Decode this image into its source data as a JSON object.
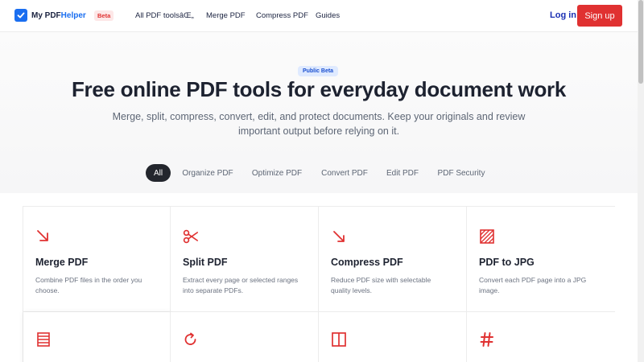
{
  "header": {
    "logo_text_prefix": "My PDF",
    "logo_text_suffix": "Helper",
    "beta_badge": "Beta",
    "nav": {
      "all_tools": "All PDF toolsâŒ„",
      "merge": "Merge PDF",
      "compress": "Compress PDF",
      "guides": "Guides"
    },
    "login": "Log in",
    "signup": "Sign up"
  },
  "hero": {
    "badge": "Public Beta",
    "title": "Free online PDF tools for everyday document work",
    "subtitle": "Merge, split, compress, convert, edit, and protect documents. Keep your originals and review important output before relying on it."
  },
  "filters": [
    {
      "label": "All",
      "active": true
    },
    {
      "label": "Organize PDF",
      "active": false
    },
    {
      "label": "Optimize PDF",
      "active": false
    },
    {
      "label": "Convert PDF",
      "active": false
    },
    {
      "label": "Edit PDF",
      "active": false
    },
    {
      "label": "PDF Security",
      "active": false
    }
  ],
  "tools": [
    {
      "title": "Merge PDF",
      "description": "Combine PDF files in the order you choose.",
      "icon": "merge-arrow-icon"
    },
    {
      "title": "Split PDF",
      "description": "Extract every page or selected ranges into separate PDFs.",
      "icon": "scissors-icon"
    },
    {
      "title": "Compress PDF",
      "description": "Reduce PDF size with selectable quality levels.",
      "icon": "compress-arrow-icon"
    },
    {
      "title": "PDF to JPG",
      "description": "Convert each PDF page into a JPG image.",
      "icon": "hatched-image-icon"
    },
    {
      "title": "",
      "description": "",
      "icon": "list-document-icon"
    },
    {
      "title": "",
      "description": "",
      "icon": "rotate-icon"
    },
    {
      "title": "",
      "description": "",
      "icon": "columns-icon"
    },
    {
      "title": "",
      "description": "",
      "icon": "hash-icon"
    }
  ],
  "colors": {
    "accent_red": "#e03131",
    "brand_blue": "#1a6ef0",
    "login_blue": "#1a2fb3",
    "dark_chip": "#23262d"
  }
}
